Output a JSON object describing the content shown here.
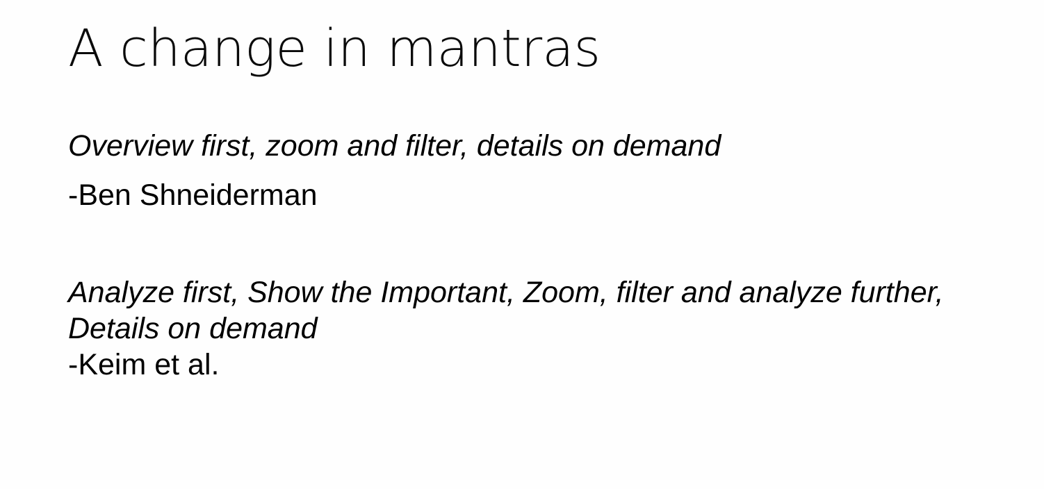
{
  "slide": {
    "title": "A change in mantras",
    "quotes": [
      {
        "lines": [
          "Overview first, zoom and filter, details on demand"
        ],
        "attribution": "-Ben Shneiderman"
      },
      {
        "lines": [
          "Analyze first, Show the Important, Zoom, filter and analyze further,",
          "Details on demand"
        ],
        "attribution": "-Keim et al."
      }
    ]
  }
}
